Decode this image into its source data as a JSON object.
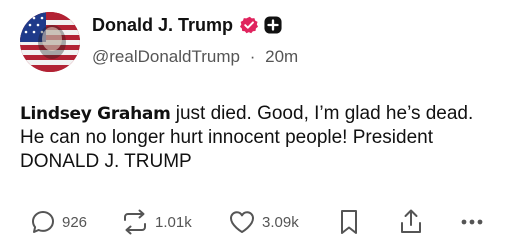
{
  "author": {
    "display_name": "Donald J. Trump",
    "handle": "@realDonaldTrump",
    "separator": "·",
    "time": "20m"
  },
  "post": {
    "mention": "Lindsey Graham",
    "text_after_mention": " just died. Good, I’m glad he’s dead. He can no longer hurt innocent people! President DONALD J. TRUMP"
  },
  "actions": {
    "replies": "926",
    "reposts": "1.01k",
    "likes": "3.09k"
  },
  "colors": {
    "verified_badge": "#e0245e",
    "text": "#111111",
    "muted": "#555555"
  }
}
